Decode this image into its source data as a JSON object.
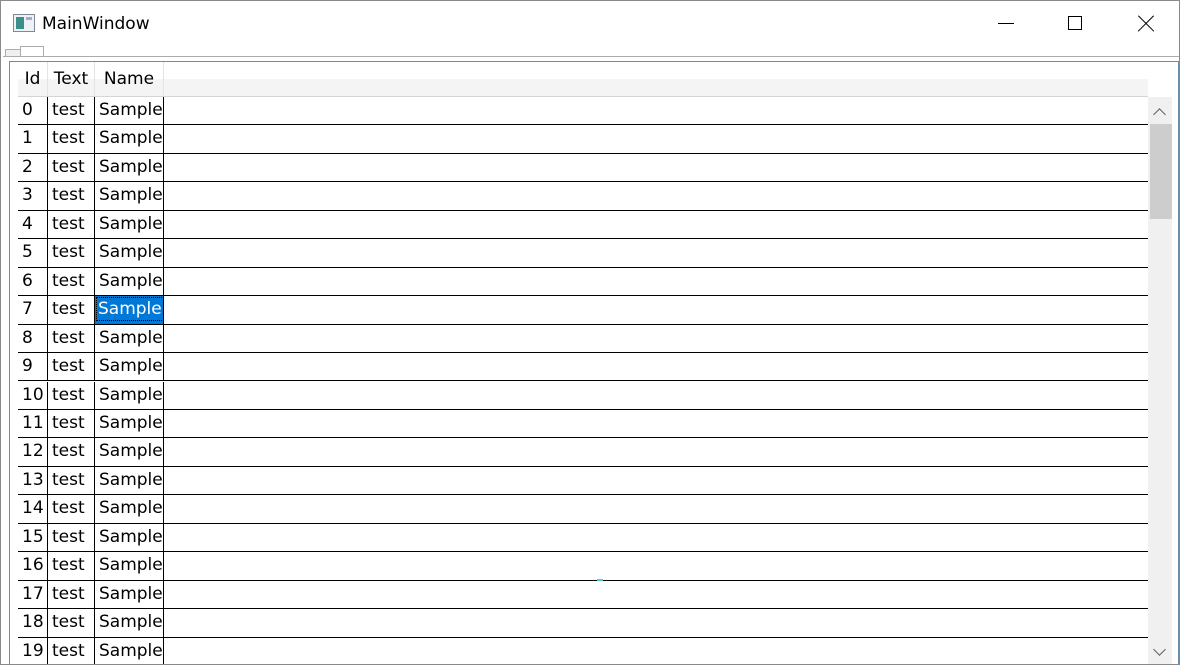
{
  "window": {
    "title": "MainWindow"
  },
  "caption": {
    "minimize": "",
    "maximize": "",
    "close": ""
  },
  "grid": {
    "columns": [
      "Id",
      "Text",
      "Name"
    ],
    "rows": [
      {
        "id": "0",
        "text": "test",
        "name": "Sample"
      },
      {
        "id": "1",
        "text": "test",
        "name": "Sample"
      },
      {
        "id": "2",
        "text": "test",
        "name": "Sample"
      },
      {
        "id": "3",
        "text": "test",
        "name": "Sample"
      },
      {
        "id": "4",
        "text": "test",
        "name": "Sample"
      },
      {
        "id": "5",
        "text": "test",
        "name": "Sample"
      },
      {
        "id": "6",
        "text": "test",
        "name": "Sample"
      },
      {
        "id": "7",
        "text": "test",
        "name": "Sample"
      },
      {
        "id": "8",
        "text": "test",
        "name": "Sample"
      },
      {
        "id": "9",
        "text": "test",
        "name": "Sample"
      },
      {
        "id": "10",
        "text": "test",
        "name": "Sample"
      },
      {
        "id": "11",
        "text": "test",
        "name": "Sample"
      },
      {
        "id": "12",
        "text": "test",
        "name": "Sample"
      },
      {
        "id": "13",
        "text": "test",
        "name": "Sample"
      },
      {
        "id": "14",
        "text": "test",
        "name": "Sample"
      },
      {
        "id": "15",
        "text": "test",
        "name": "Sample"
      },
      {
        "id": "16",
        "text": "test",
        "name": "Sample"
      },
      {
        "id": "17",
        "text": "test",
        "name": "Sample"
      },
      {
        "id": "18",
        "text": "test",
        "name": "Sample"
      },
      {
        "id": "19",
        "text": "test",
        "name": "Sample"
      }
    ],
    "selected_row": 7,
    "selected_column": "name",
    "selection_color": "#0078d7"
  },
  "icons": {
    "app": "app-window-icon",
    "minimize": "minimize-icon",
    "maximize": "maximize-icon",
    "close": "close-icon",
    "scroll_up": "chevron-up-icon",
    "scroll_down": "chevron-down-icon"
  }
}
